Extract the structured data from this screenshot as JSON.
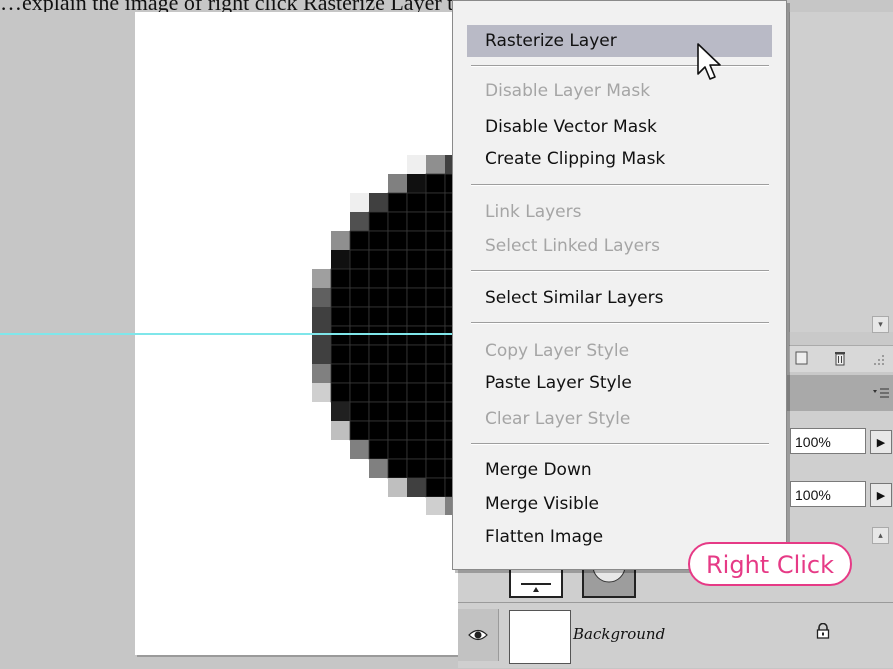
{
  "caption": {
    "text": "…explain the image of right click Rasterize Layer to remove options"
  },
  "context_menu": {
    "items": [
      {
        "label": "Rasterize Layer",
        "state": "highlighted"
      },
      {
        "label": "Disable Layer Mask",
        "state": "disabled"
      },
      {
        "label": "Disable Vector Mask",
        "state": "enabled"
      },
      {
        "label": "Create Clipping Mask",
        "state": "enabled"
      },
      {
        "label": "Link Layers",
        "state": "disabled"
      },
      {
        "label": "Select Linked Layers",
        "state": "disabled"
      },
      {
        "label": "Select Similar Layers",
        "state": "enabled"
      },
      {
        "label": "Copy Layer Style",
        "state": "disabled"
      },
      {
        "label": "Paste Layer Style",
        "state": "enabled"
      },
      {
        "label": "Clear Layer Style",
        "state": "disabled"
      },
      {
        "label": "Merge Down",
        "state": "enabled"
      },
      {
        "label": "Merge Visible",
        "state": "enabled"
      },
      {
        "label": "Flatten Image",
        "state": "enabled"
      }
    ]
  },
  "layers_panel": {
    "opacity_value": "100%",
    "fill_value": "100%",
    "layers": [
      {
        "name": "Background",
        "locked": true,
        "visible": true
      }
    ]
  },
  "callout": {
    "text": "Right Click"
  },
  "colors": {
    "guide": "#7fe6ea",
    "callout": "#e63a86",
    "menu_highlight": "#b9bac6"
  },
  "icons": [
    "eye-icon",
    "lock-icon",
    "arrow-cursor-icon",
    "trash-icon",
    "panel-menu-icon",
    "chevron-right-icon",
    "scroll-up-icon",
    "scroll-down-icon"
  ]
}
